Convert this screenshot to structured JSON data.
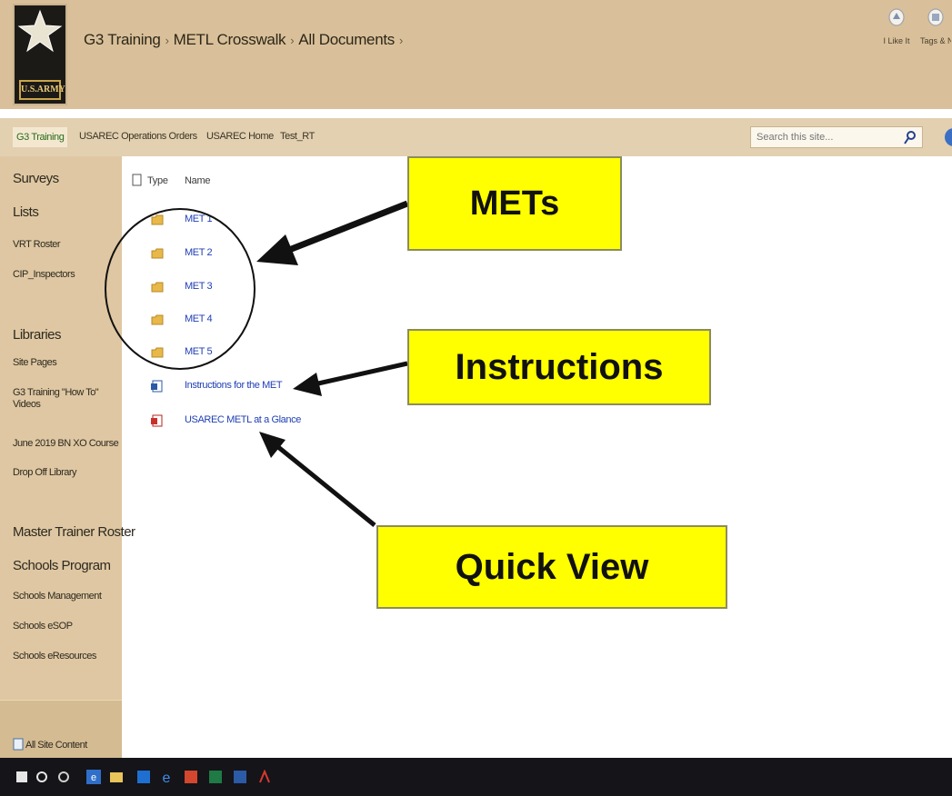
{
  "header": {
    "logo_text": "U.S.ARMY",
    "breadcrumb": [
      "G3 Training",
      "METL Crosswalk",
      "All Documents"
    ],
    "breadcrumb_sep": "›",
    "actions": [
      {
        "label": "I Like It",
        "icon": "thumbs-up-icon"
      },
      {
        "label": "Tags & Notes",
        "icon": "tag-icon"
      }
    ]
  },
  "topnav": {
    "active": "G3 Training",
    "items": [
      "USAREC Operations Orders",
      "USAREC Home",
      "Test_RT"
    ]
  },
  "search": {
    "placeholder": "Search this site..."
  },
  "leftnav": {
    "surveys": "Surveys",
    "lists": "Lists",
    "list_items": [
      "VRT Roster",
      "CIP_Inspectors"
    ],
    "libraries": "Libraries",
    "library_items": [
      "Site Pages",
      "G3 Training \"How To\" Videos",
      "June 2019 BN XO Course",
      "Drop Off Library"
    ],
    "master_trainer": "Master Trainer Roster",
    "schools_program": "Schools Program",
    "schools_items": [
      "Schools Management",
      "Schools eSOP",
      "Schools eResources"
    ],
    "all_site_content": "All Site Content"
  },
  "list": {
    "col_type": "Type",
    "col_name": "Name",
    "rows": [
      {
        "name": "MET 1",
        "icon": "folder-icon"
      },
      {
        "name": "MET 2",
        "icon": "folder-icon"
      },
      {
        "name": "MET 3",
        "icon": "folder-icon"
      },
      {
        "name": "MET 4",
        "icon": "folder-icon"
      },
      {
        "name": "MET 5",
        "icon": "folder-icon"
      },
      {
        "name": "Instructions for the MET",
        "icon": "word-doc-icon"
      },
      {
        "name": "USAREC METL at a Glance",
        "icon": "pdf-icon"
      }
    ]
  },
  "callouts": {
    "mets": "METs",
    "instructions": "Instructions",
    "quick_view": "Quick View"
  },
  "colors": {
    "header_bg": "#d9c09a",
    "nav_bg": "#dec7a2",
    "link": "#1f3fb5",
    "callout_bg": "#ffff00",
    "taskbar": "#141419"
  },
  "taskbar": {
    "icons": [
      "windows-start-icon",
      "search-icon",
      "task-view-icon",
      "ie-icon",
      "file-explorer-icon",
      "outlook-icon",
      "edge-icon",
      "powerpoint-icon",
      "excel-icon",
      "word-icon",
      "acrobat-icon"
    ]
  }
}
